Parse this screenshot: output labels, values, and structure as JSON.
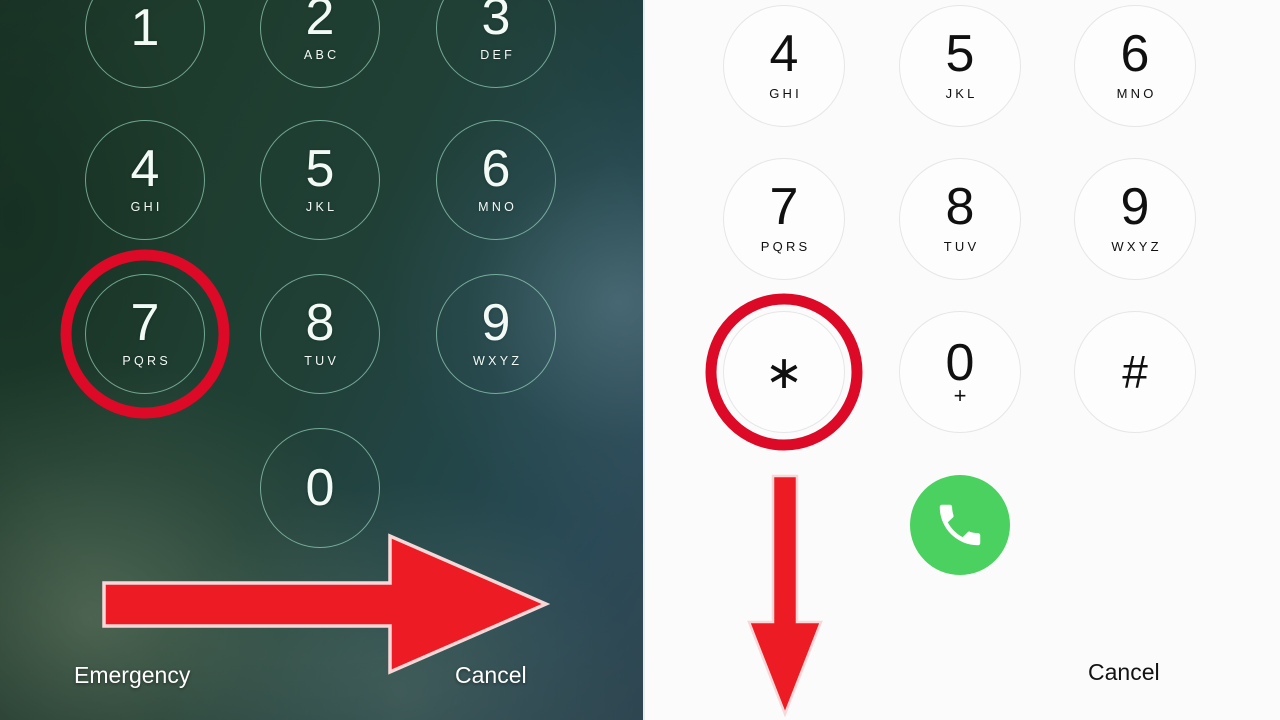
{
  "left_panel": {
    "name": "ios-lockscreen-passcode-keypad",
    "background_colors": {
      "dark_green": "#1d3a2b",
      "teal": "#2b4a57",
      "key_stroke": "#a8e6cd"
    },
    "keys": [
      {
        "digit": "1",
        "letters": ""
      },
      {
        "digit": "2",
        "letters": "ABC"
      },
      {
        "digit": "3",
        "letters": "DEF"
      },
      {
        "digit": "4",
        "letters": "GHI"
      },
      {
        "digit": "5",
        "letters": "JKL"
      },
      {
        "digit": "6",
        "letters": "MNO"
      },
      {
        "digit": "7",
        "letters": "PQRS"
      },
      {
        "digit": "8",
        "letters": "TUV"
      },
      {
        "digit": "9",
        "letters": "WXYZ"
      },
      {
        "digit": "0",
        "letters": ""
      }
    ],
    "highlighted_key": "7",
    "emergency_label": "Emergency",
    "cancel_label": "Cancel"
  },
  "right_panel": {
    "name": "phone-dialer-keypad",
    "background_color": "#fbfbfb",
    "keys": [
      {
        "digit": "4",
        "letters": "GHI"
      },
      {
        "digit": "5",
        "letters": "JKL"
      },
      {
        "digit": "6",
        "letters": "MNO"
      },
      {
        "digit": "7",
        "letters": "PQRS"
      },
      {
        "digit": "8",
        "letters": "TUV"
      },
      {
        "digit": "9",
        "letters": "WXYZ"
      },
      {
        "digit": "∗",
        "letters": ""
      },
      {
        "digit": "0",
        "letters": "+"
      },
      {
        "digit": "#",
        "letters": ""
      }
    ],
    "highlighted_key": "∗",
    "call_button_color": "#4ad15f",
    "call_button_icon": "phone-icon",
    "cancel_label": "Cancel"
  },
  "annotations": {
    "highlight_color": "#dc0a26",
    "arrow_color": "#ed1c24",
    "right_arrow_direction": "right",
    "down_arrow_direction": "down"
  }
}
